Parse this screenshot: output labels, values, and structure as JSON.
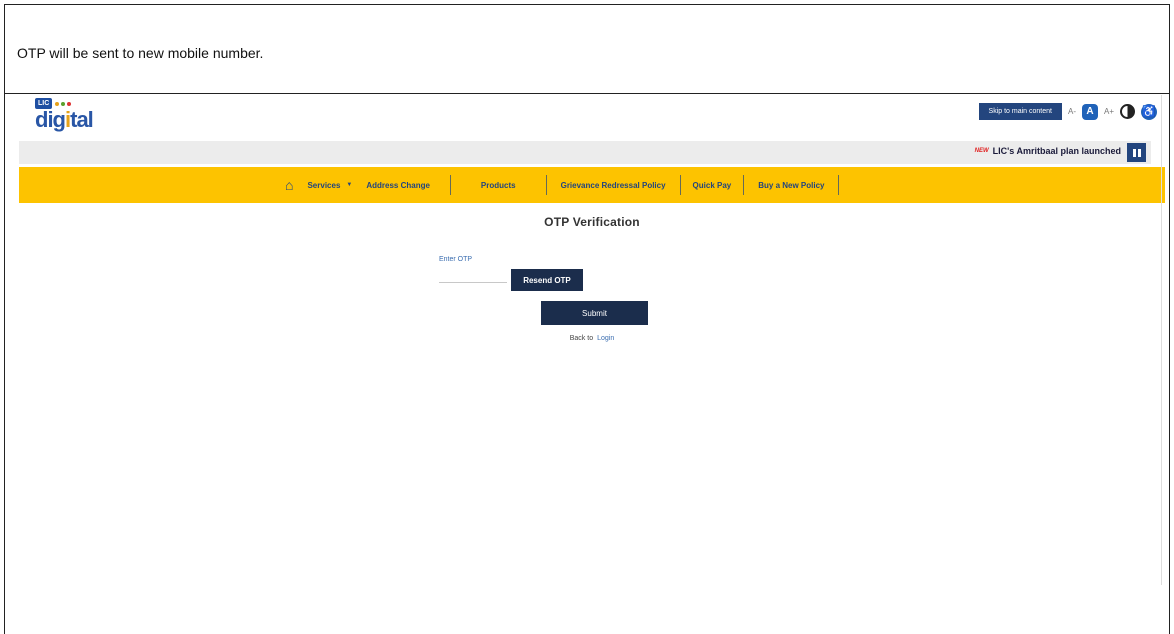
{
  "caption": "OTP will be sent to new mobile number.",
  "header": {
    "logo_badge": "LIC",
    "logo_word_pre": "dig",
    "logo_word_o": "i",
    "logo_word_post": "tal",
    "skip_label": "Skip to main content",
    "font_small": "A-",
    "font_normal": "A",
    "font_large": "A+"
  },
  "ticker": {
    "new_tag": "NEW",
    "text": "LIC's Amritbaal plan launched"
  },
  "nav": {
    "items": [
      "Services",
      "Address Change",
      "Products",
      "Grievance Redressal Policy",
      "Quick Pay",
      "Buy a New Policy"
    ],
    "caret": "▼",
    "home_icon": "home-icon"
  },
  "form": {
    "title": "OTP Verification",
    "otp_label": "Enter OTP",
    "otp_value": "",
    "resend_label": "Resend OTP",
    "submit_label": "Submit",
    "back_text": "Back to",
    "back_link": "Login"
  },
  "colors": {
    "nav_yellow": "#fdc300",
    "navy": "#1b2d4c",
    "brand_blue": "#1f62b8"
  }
}
